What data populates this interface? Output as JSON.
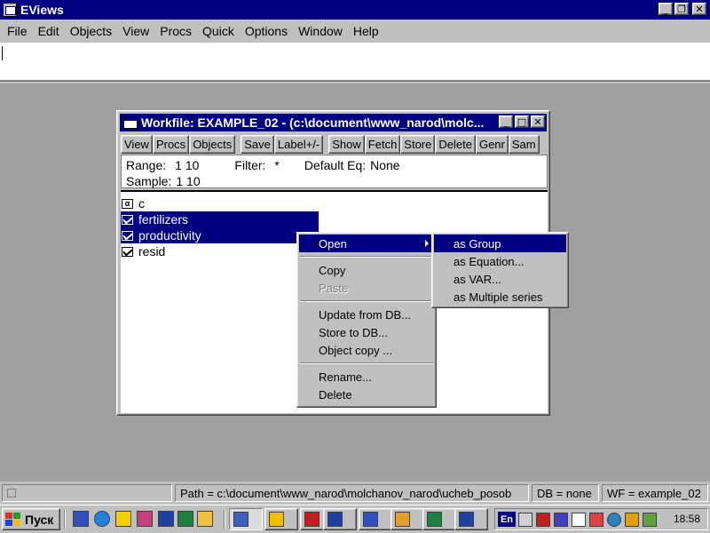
{
  "app": {
    "title": "EViews",
    "menu": [
      "File",
      "Edit",
      "Objects",
      "View",
      "Procs",
      "Quick",
      "Options",
      "Window",
      "Help"
    ]
  },
  "workfile": {
    "title": "Workfile: EXAMPLE_02 - (c:\\document\\www_narod\\molc...",
    "toolbar": [
      "View",
      "Procs",
      "Objects",
      "Save",
      "Label+/-",
      "Show",
      "Fetch",
      "Store",
      "Delete",
      "Genr",
      "Sam"
    ],
    "range_label": "Range:",
    "range_value": "1 10",
    "filter_label": "Filter:",
    "filter_value": "*",
    "default_eq_label": "Default Eq:",
    "default_eq_value": "None",
    "sample_label": "Sample:",
    "sample_value": "1 10",
    "objects": [
      {
        "name": "c",
        "icon": "coef-icon",
        "selected": false
      },
      {
        "name": "fertilizers",
        "icon": "series-icon",
        "selected": true
      },
      {
        "name": "productivity",
        "icon": "series-icon",
        "selected": true
      },
      {
        "name": "resid",
        "icon": "series-icon",
        "selected": false
      }
    ]
  },
  "context_menu": {
    "open": "Open",
    "copy": "Copy",
    "paste": "Paste",
    "update_db": "Update from DB...",
    "store_db": "Store to DB...",
    "object_copy": "Object copy ...",
    "rename": "Rename...",
    "delete": "Delete"
  },
  "submenu": {
    "as_group": "as Group",
    "as_equation": "as Equation...",
    "as_var": "as VAR...",
    "as_multiple": "as Multiple series"
  },
  "status": {
    "path": "Path = c:\\document\\www_narod\\molchanov_narod\\ucheb_posob",
    "db": "DB = none",
    "wf": "WF = example_02"
  },
  "taskbar": {
    "start": "Пуск",
    "lang": "En",
    "clock": "18:58"
  },
  "colors": {
    "title_bar": "#000080",
    "selection": "#000080",
    "face": "#c0c0c0",
    "workspace": "#a0a0a0"
  }
}
